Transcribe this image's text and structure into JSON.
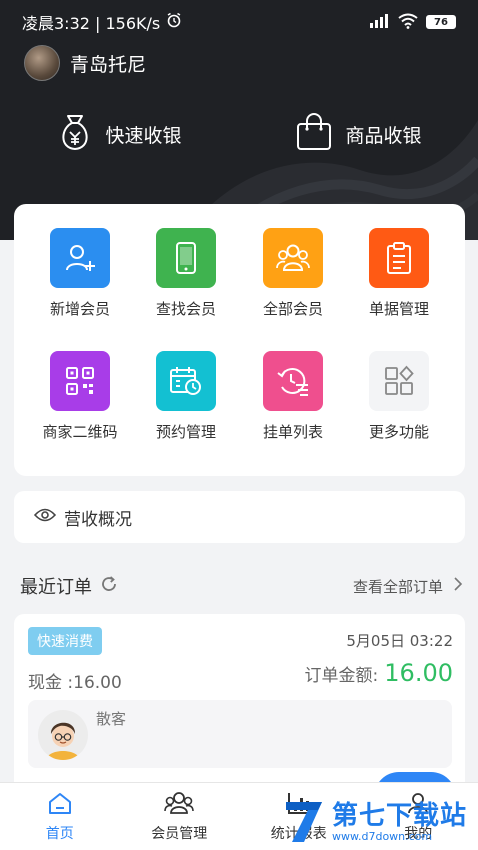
{
  "status_bar": {
    "time_speed": "凌晨3:32 | 156K/s",
    "battery": "76"
  },
  "user": {
    "name": "青岛托尼"
  },
  "quick_actions": [
    {
      "label": "快速收银",
      "icon": "money-bag-icon"
    },
    {
      "label": "商品收银",
      "icon": "shopping-bag-icon"
    }
  ],
  "grid": [
    {
      "label": "新增会员",
      "icon": "add-user-icon",
      "color": "#2b8ef0"
    },
    {
      "label": "查找会员",
      "icon": "phone-icon",
      "color": "#3fb34f"
    },
    {
      "label": "全部会员",
      "icon": "users-icon",
      "color": "#ffa114"
    },
    {
      "label": "单据管理",
      "icon": "clipboard-icon",
      "color": "#ff5a14"
    },
    {
      "label": "商家二维码",
      "icon": "qr-code-icon",
      "color": "#a83de8"
    },
    {
      "label": "预约管理",
      "icon": "calendar-clock-icon",
      "color": "#13c0d2"
    },
    {
      "label": "挂单列表",
      "icon": "history-list-icon",
      "color": "#ef4f8e"
    },
    {
      "label": "更多功能",
      "icon": "grid-more-icon",
      "color": "#f3f4f6"
    }
  ],
  "revenue": {
    "label": "营收概况"
  },
  "recent_orders": {
    "title": "最近订单",
    "view_all": "查看全部订单"
  },
  "order": {
    "tag": "快速消费",
    "time": "5月05日 03:22",
    "payment": "现金 :16.00",
    "total_label": "订单金额:",
    "total_value": "16.00",
    "customer": "散客"
  },
  "bottom_nav": [
    {
      "label": "首页",
      "icon": "home-icon",
      "active": true
    },
    {
      "label": "会员管理",
      "icon": "members-icon",
      "active": false
    },
    {
      "label": "统计报表",
      "icon": "chart-icon",
      "active": false
    },
    {
      "label": "我的",
      "icon": "profile-icon",
      "active": false
    }
  ],
  "watermark": {
    "title": "第七下载站",
    "url": "www.d7down.com"
  }
}
